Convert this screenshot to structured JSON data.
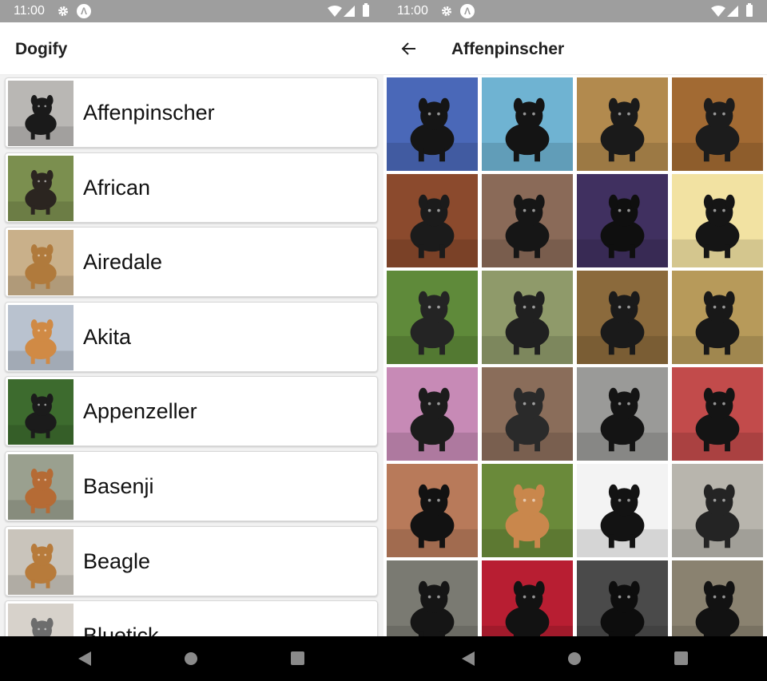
{
  "status_bar": {
    "time": "11:00"
  },
  "list_screen": {
    "title": "Dogify",
    "breeds": [
      {
        "name": "Affenpinscher",
        "bg": "#b9b7b4",
        "dog": "#1a1a1a"
      },
      {
        "name": "African",
        "bg": "#7b8f4f",
        "dog": "#2b2520"
      },
      {
        "name": "Airedale",
        "bg": "#c9b08a",
        "dog": "#b07a3c"
      },
      {
        "name": "Akita",
        "bg": "#b9c2cf",
        "dog": "#d08a45"
      },
      {
        "name": "Appenzeller",
        "bg": "#3d6b2e",
        "dog": "#1b1b1b"
      },
      {
        "name": "Basenji",
        "bg": "#9aa08f",
        "dog": "#b56b35"
      },
      {
        "name": "Beagle",
        "bg": "#c9c4bb",
        "dog": "#b77b3b"
      },
      {
        "name": "Bluetick",
        "bg": "#d7d2cb",
        "dog": "#6d6d6d"
      }
    ]
  },
  "detail_screen": {
    "title": "Affenpinscher",
    "tiles": [
      {
        "bg": "#4a68b8",
        "dog": "#151515"
      },
      {
        "bg": "#6fb3d2",
        "dog": "#141414"
      },
      {
        "bg": "#b28a4e",
        "dog": "#1a1a1a"
      },
      {
        "bg": "#a26a33",
        "dog": "#1c1c1c"
      },
      {
        "bg": "#8b4a2d",
        "dog": "#1b1b1b"
      },
      {
        "bg": "#8a6a58",
        "dog": "#161616"
      },
      {
        "bg": "#403060",
        "dog": "#0f0f0f"
      },
      {
        "bg": "#f2e2a2",
        "dog": "#151515"
      },
      {
        "bg": "#5f8a3a",
        "dog": "#242424"
      },
      {
        "bg": "#8f9a6a",
        "dog": "#202020"
      },
      {
        "bg": "#8b6a3c",
        "dog": "#1a1a1a"
      },
      {
        "bg": "#b79a5a",
        "dog": "#181818"
      },
      {
        "bg": "#c78ab6",
        "dog": "#1c1c1c"
      },
      {
        "bg": "#8a6d5a",
        "dog": "#2a2a2a"
      },
      {
        "bg": "#9a9a98",
        "dog": "#141414"
      },
      {
        "bg": "#c24b4b",
        "dog": "#141414"
      },
      {
        "bg": "#b87a5a",
        "dog": "#121212"
      },
      {
        "bg": "#6a8a3a",
        "dog": "#c9874c"
      },
      {
        "bg": "#f3f3f3",
        "dog": "#131313"
      },
      {
        "bg": "#b8b5ad",
        "dog": "#242424"
      },
      {
        "bg": "#7a7a72",
        "dog": "#151515"
      },
      {
        "bg": "#b81e32",
        "dog": "#121212"
      },
      {
        "bg": "#4a4a4a",
        "dog": "#0d0d0d"
      },
      {
        "bg": "#8a8270",
        "dog": "#121212"
      }
    ]
  },
  "nav_bar": {
    "back": "back-triangle",
    "home": "home-circle",
    "recents": "recents-square"
  }
}
